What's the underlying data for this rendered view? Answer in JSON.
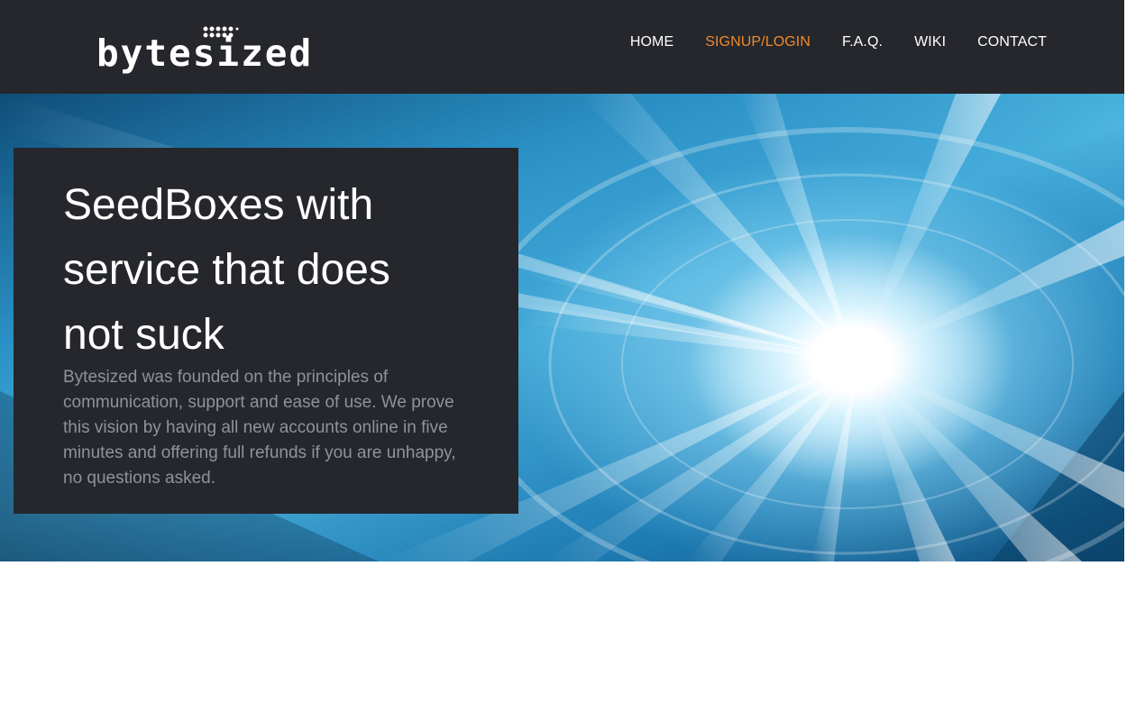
{
  "header": {
    "logo_text": "bytesized",
    "nav": [
      {
        "label": "HOME",
        "active": false
      },
      {
        "label": "SIGNUP/LOGIN",
        "active": true
      },
      {
        "label": "F.A.Q.",
        "active": false
      },
      {
        "label": "WIKI",
        "active": false
      },
      {
        "label": "CONTACT",
        "active": false
      }
    ]
  },
  "hero": {
    "title": "SeedBoxes with service that does not suck",
    "description": "Bytesized was founded on the principles of communication, support and ease of use. We prove this vision by having all new accounts online in five minutes and offering full refunds if you are unhappy, no questions asked."
  },
  "colors": {
    "header_bg": "#25272c",
    "nav_active": "#f08a2c",
    "card_bg": "#25272c",
    "body_text": "#8f9399"
  }
}
